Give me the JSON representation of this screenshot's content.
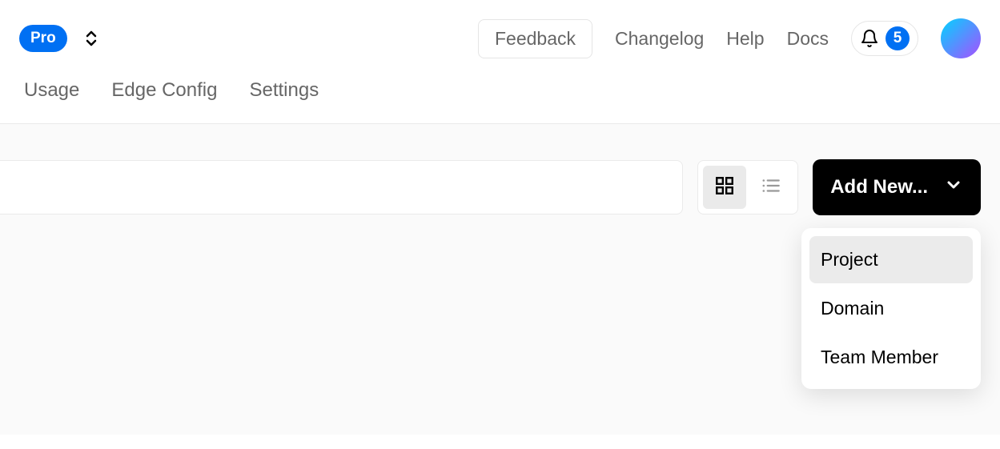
{
  "header": {
    "pro_label": "Pro",
    "feedback_label": "Feedback",
    "links": {
      "changelog": "Changelog",
      "help": "Help",
      "docs": "Docs"
    },
    "notification_count": "5"
  },
  "subnav": {
    "items": [
      "Usage",
      "Edge Config",
      "Settings"
    ]
  },
  "toolbar": {
    "addnew_label": "Add New..."
  },
  "addnew_menu": {
    "items": [
      "Project",
      "Domain",
      "Team Member"
    ]
  }
}
